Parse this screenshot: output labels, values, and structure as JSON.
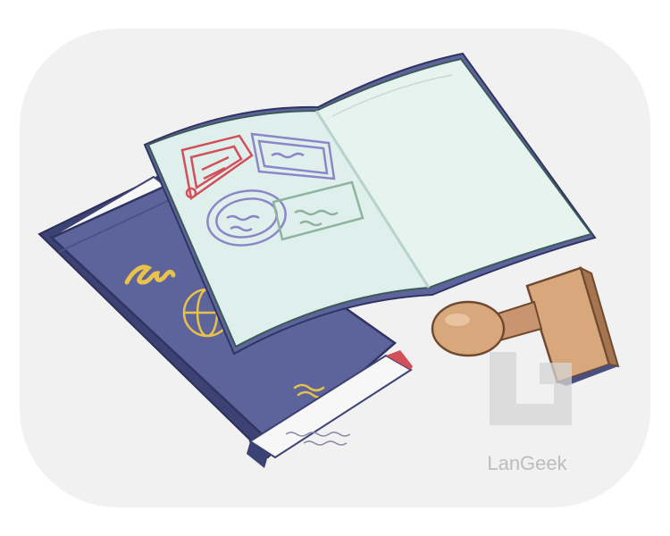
{
  "image": {
    "subject": "passport",
    "watermark_text": "LanGeek"
  },
  "colors": {
    "background": "#ffffff",
    "backdrop": "#f1f1f1",
    "cover": "#5d649c",
    "cover_dark": "#3c4273",
    "page": "#dff0ec",
    "stamp_red": "#d2505a",
    "stamp_purple": "#8a86c7",
    "stamp_green": "#8fb39f",
    "gold": "#e8c24a",
    "wood": "#d9a77c",
    "wood_dark": "#a57550",
    "watermark": "#d4d4d4"
  }
}
